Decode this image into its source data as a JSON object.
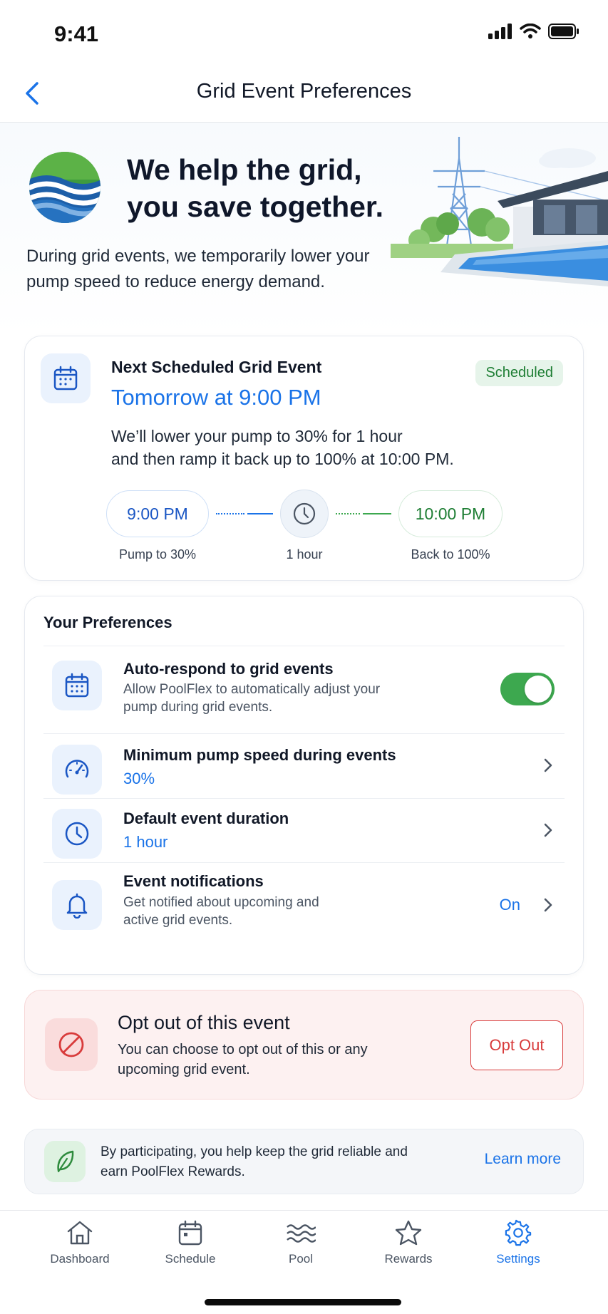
{
  "status_bar": {
    "time": "9:41"
  },
  "nav": {
    "title": "Grid Event Preferences"
  },
  "hero": {
    "title_line1": "We help the grid,",
    "title_line2": "you save together.",
    "subtitle": "During grid events, we temporarily lower your pump speed to reduce energy demand."
  },
  "event": {
    "label": "Next Scheduled Grid Event",
    "time": "Tomorrow at 9:00 PM",
    "badge": "Scheduled",
    "desc_line1": "We’ll lower your pump to 30% for 1 hour",
    "desc_line2": "and then ramp it back up to 100% at 10:00 PM.",
    "timeline": {
      "start_time": "9:00 PM",
      "start_caption": "Pump to 30%",
      "duration_caption": "1 hour",
      "end_time": "10:00 PM",
      "end_caption": "Back to 100%"
    }
  },
  "preferences": {
    "heading": "Your Preferences",
    "items": [
      {
        "title": "Auto-respond to grid events",
        "subtitle_line1": "Allow PoolFlex to automatically adjust your",
        "subtitle_line2": "pump during grid events.",
        "toggle_on": true
      },
      {
        "title": "Minimum pump speed during events",
        "value": "30%"
      },
      {
        "title": "Default event duration",
        "value": "1 hour"
      },
      {
        "title": "Event notifications",
        "subtitle_line1": "Get notified about upcoming and",
        "subtitle_line2": "active grid events.",
        "value": "On"
      }
    ]
  },
  "optout": {
    "title": "Opt out of this event",
    "subtitle_line1": "You can choose to opt out of this or any",
    "subtitle_line2": "upcoming grid event.",
    "button": "Opt Out"
  },
  "info": {
    "text_line1": "By participating, you help keep the grid reliable and",
    "text_line2": "earn PoolFlex Rewards.",
    "link": "Learn more"
  },
  "tabs": [
    {
      "label": "Dashboard",
      "icon": "home-icon"
    },
    {
      "label": "Schedule",
      "icon": "calendar-icon"
    },
    {
      "label": "Pool",
      "icon": "waves-icon"
    },
    {
      "label": "Rewards",
      "icon": "star-icon"
    },
    {
      "label": "Settings",
      "icon": "gear-icon",
      "active": true
    }
  ],
  "colors": {
    "accent": "#1a73e8",
    "success": "#3da84f",
    "danger": "#d83b3b"
  }
}
